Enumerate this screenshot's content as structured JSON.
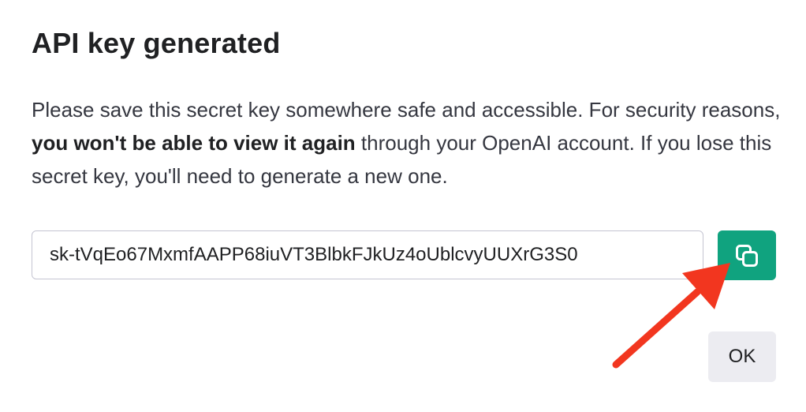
{
  "dialog": {
    "title": "API key generated",
    "message": {
      "part1": "Please save this secret key somewhere safe and accessible. For security reasons, ",
      "bold": "you won't be able to view it again",
      "part2": " through your OpenAI account. If you lose this secret key, you'll need to generate a new one."
    },
    "secret_key": "sk-tVqEo67MxmfAAPP68iuVT3BlbkFJkUz4oUblcvyUUXrG3S0",
    "copy_icon": "copy-icon",
    "ok_label": "OK"
  },
  "colors": {
    "accent_green": "#10a37f",
    "annotation_arrow": "#f2361f",
    "ok_button_bg": "#ececf1"
  }
}
